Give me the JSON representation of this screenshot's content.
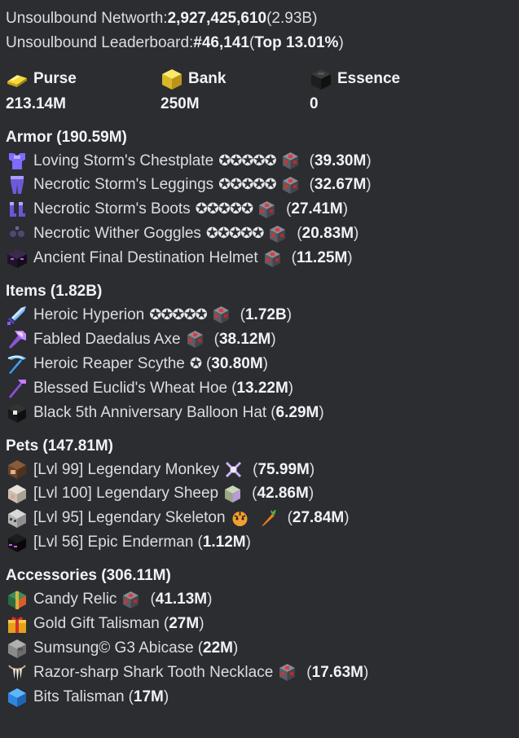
{
  "summary": {
    "networth_label": "Unsoulbound Networth: ",
    "networth_value": "2,927,425,610",
    "networth_short": " (2.93B)",
    "leaderboard_label": "Unsoulbound Leaderboard: ",
    "leaderboard_rank": "#46,141",
    "leaderboard_open": " (",
    "leaderboard_top": "Top 13.01%",
    "leaderboard_close": ")"
  },
  "stats": [
    {
      "icon": "gold-ingot-icon",
      "label": "Purse",
      "value": "213.14M"
    },
    {
      "icon": "gold-block-icon",
      "label": "Bank",
      "value": "250M"
    },
    {
      "icon": "wither-essence-icon",
      "label": "Essence",
      "value": "0"
    }
  ],
  "sections": [
    {
      "title": "Armor (190.59M)",
      "items": [
        {
          "icon": "chestplate-icon",
          "name": "Loving Storm's Chestplate",
          "stars": "✪✪✪✪✪",
          "gems": [
            "gem-icon"
          ],
          "value": "39.30M"
        },
        {
          "icon": "leggings-icon",
          "name": "Necrotic Storm's Leggings",
          "stars": "✪✪✪✪✪",
          "gems": [
            "gem-icon"
          ],
          "value": "32.67M"
        },
        {
          "icon": "boots-icon",
          "name": "Necrotic Storm's Boots",
          "stars": "✪✪✪✪✪",
          "gems": [
            "gem-icon"
          ],
          "value": "27.41M"
        },
        {
          "icon": "goggles-icon",
          "name": "Necrotic Wither Goggles",
          "stars": "✪✪✪✪✪",
          "gems": [
            "gem-icon"
          ],
          "value": "20.83M"
        },
        {
          "icon": "helmet-icon",
          "name": "Ancient Final Destination Helmet",
          "stars": "",
          "gems": [
            "gem-icon"
          ],
          "value": "11.25M"
        }
      ]
    },
    {
      "title": "Items (1.82B)",
      "items": [
        {
          "icon": "sword-icon",
          "name": "Heroic Hyperion",
          "stars": "✪✪✪✪✪",
          "gems": [
            "gem-icon"
          ],
          "value": "1.72B"
        },
        {
          "icon": "axe-icon",
          "name": "Fabled Daedalus Axe",
          "stars": "",
          "gems": [
            "gem-icon"
          ],
          "value": "38.12M"
        },
        {
          "icon": "scythe-icon",
          "name": "Heroic Reaper Scythe",
          "stars": "✪",
          "gems": [],
          "value": "30.80M"
        },
        {
          "icon": "hoe-icon",
          "name": "Blessed Euclid's Wheat Hoe",
          "stars": "",
          "gems": [],
          "value": "13.22M"
        },
        {
          "icon": "balloon-hat-icon",
          "name": "Black 5th Anniversary Balloon Hat",
          "stars": "",
          "gems": [],
          "value": "6.29M"
        }
      ]
    },
    {
      "title": "Pets (147.81M)",
      "items": [
        {
          "icon": "monkey-head-icon",
          "name": "[Lvl 99] Legendary Monkey",
          "stars": "",
          "gems": [
            "pet-item-icon"
          ],
          "value": "75.99M"
        },
        {
          "icon": "sheep-head-icon",
          "name": "[Lvl 100] Legendary Sheep",
          "stars": "",
          "gems": [
            "pet-skin-icon"
          ],
          "value": "42.86M"
        },
        {
          "icon": "skeleton-head-icon",
          "name": "[Lvl 95] Legendary Skeleton",
          "stars": "",
          "gems": [
            "tiger-icon",
            "carrot-icon"
          ],
          "value": "27.84M"
        },
        {
          "icon": "enderman-head-icon",
          "name": "[Lvl 56] Epic Enderman",
          "stars": "",
          "gems": [],
          "value": "1.12M"
        }
      ]
    },
    {
      "title": "Accessories (306.11M)",
      "items": [
        {
          "icon": "candy-relic-icon",
          "name": "Candy Relic",
          "stars": "",
          "gems": [
            "gem-icon"
          ],
          "value": "41.13M"
        },
        {
          "icon": "gift-icon",
          "name": "Gold Gift Talisman",
          "stars": "",
          "gems": [],
          "value": "27M"
        },
        {
          "icon": "abicase-icon",
          "name": "Sumsung© G3 Abicase",
          "stars": "",
          "gems": [],
          "value": "22M"
        },
        {
          "icon": "shark-tooth-icon",
          "name": "Razor-sharp Shark Tooth Necklace",
          "stars": "",
          "gems": [
            "gem-icon"
          ],
          "value": "17.63M"
        },
        {
          "icon": "bits-icon",
          "name": "Bits Talisman",
          "stars": "",
          "gems": [],
          "value": "17M"
        }
      ]
    }
  ]
}
